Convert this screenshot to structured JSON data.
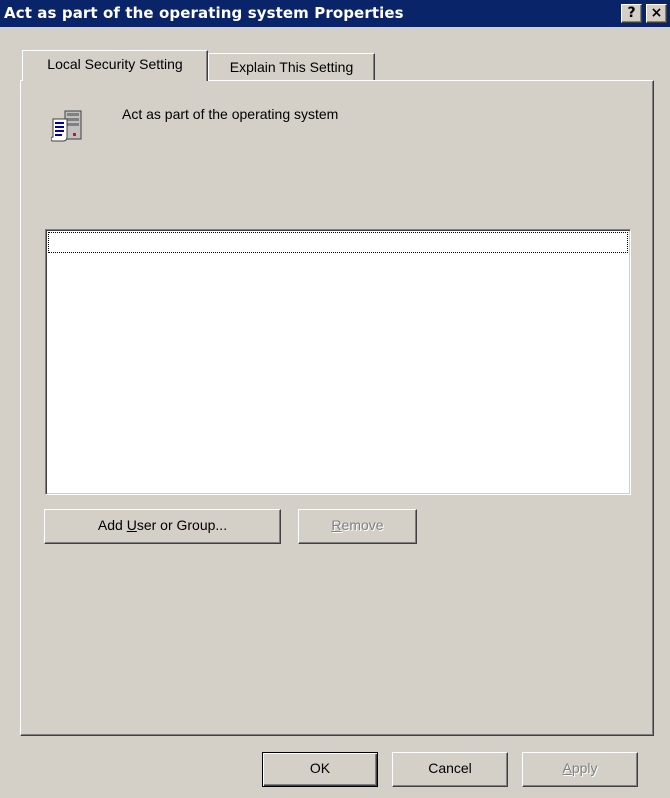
{
  "window": {
    "title": "Act as part of the operating system Properties",
    "help_button": "?",
    "close_button": "×"
  },
  "tabs": [
    {
      "label": "Local Security Setting",
      "active": true
    },
    {
      "label": "Explain This Setting",
      "active": false
    }
  ],
  "policy": {
    "icon": "policy-document-icon",
    "name": "Act as part of the operating system"
  },
  "members_list": {
    "items": []
  },
  "buttons": {
    "add": {
      "pre": "Add ",
      "mnemonic": "U",
      "post": "ser or Group..."
    },
    "remove": {
      "pre": "",
      "mnemonic": "R",
      "post": "emove",
      "enabled": false
    },
    "ok": "OK",
    "cancel": "Cancel",
    "apply": {
      "pre": "",
      "mnemonic": "A",
      "post": "pply",
      "enabled": false
    }
  },
  "colors": {
    "titlebar": "#0a246a",
    "face": "#d4d0c8"
  }
}
